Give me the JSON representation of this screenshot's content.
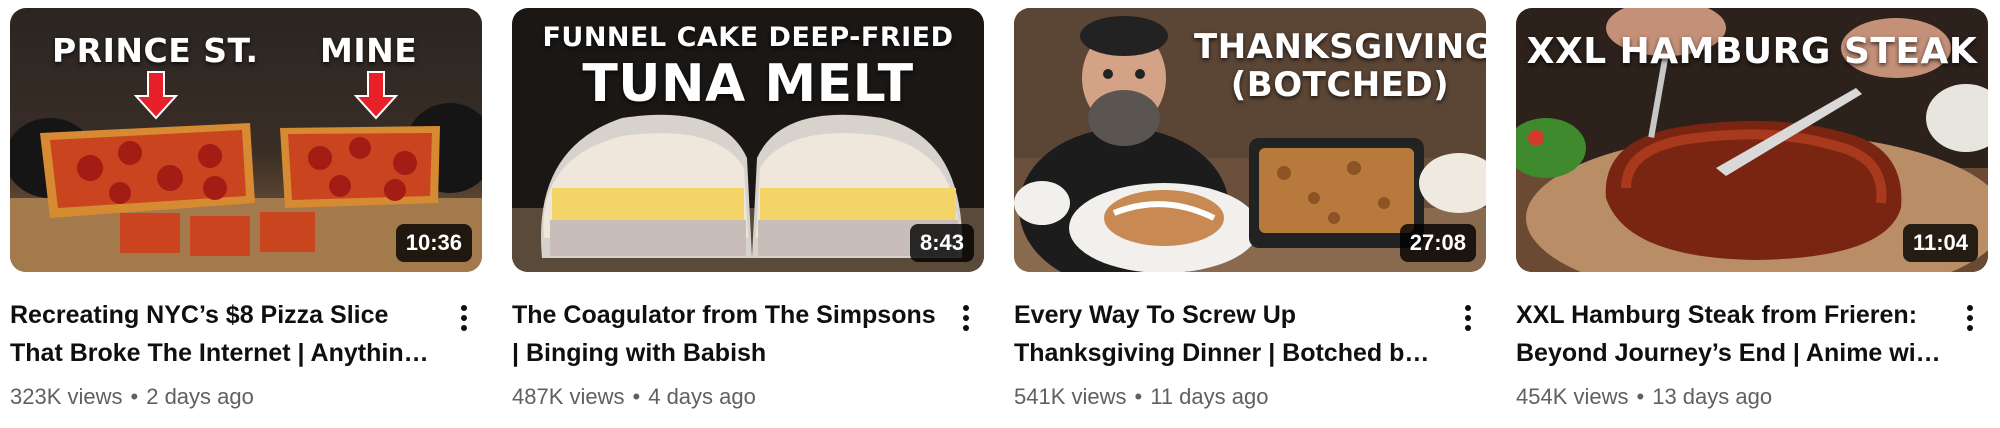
{
  "videos": [
    {
      "thumb_labels": [
        "PRINCE ST.",
        "MINE"
      ],
      "duration": "10:36",
      "title": "Recreating NYC’s $8 Pizza Slice That Broke The Internet | Anything With Alvin",
      "views": "323K views",
      "age": "2 days ago"
    },
    {
      "thumb_labels": [
        "FUNNEL CAKE DEEP-FRIED",
        "TUNA MELT"
      ],
      "duration": "8:43",
      "title": "The Coagulator from The Simpsons | Binging with Babish",
      "views": "487K views",
      "age": "4 days ago"
    },
    {
      "thumb_labels": [
        "THANKSGIVING",
        "(BOTCHED)"
      ],
      "duration": "27:08",
      "title": "Every Way To Screw Up Thanksgiving Dinner | Botched by Babish",
      "views": "541K views",
      "age": "11 days ago"
    },
    {
      "thumb_labels": [
        "XXL HAMBURG STEAK"
      ],
      "duration": "11:04",
      "title": "XXL Hamburg Steak from Frieren: Beyond Journey’s End | Anime with Alvin",
      "views": "454K views",
      "age": "13 days ago"
    }
  ],
  "separator": "•",
  "icons": {
    "more": "more-vert-icon",
    "arrow": "red-arrow-icon"
  },
  "colors": {
    "title": "#0f0f0f",
    "meta": "#606060",
    "duration_bg": "#000000cc",
    "arrow_red": "#e8202a"
  }
}
